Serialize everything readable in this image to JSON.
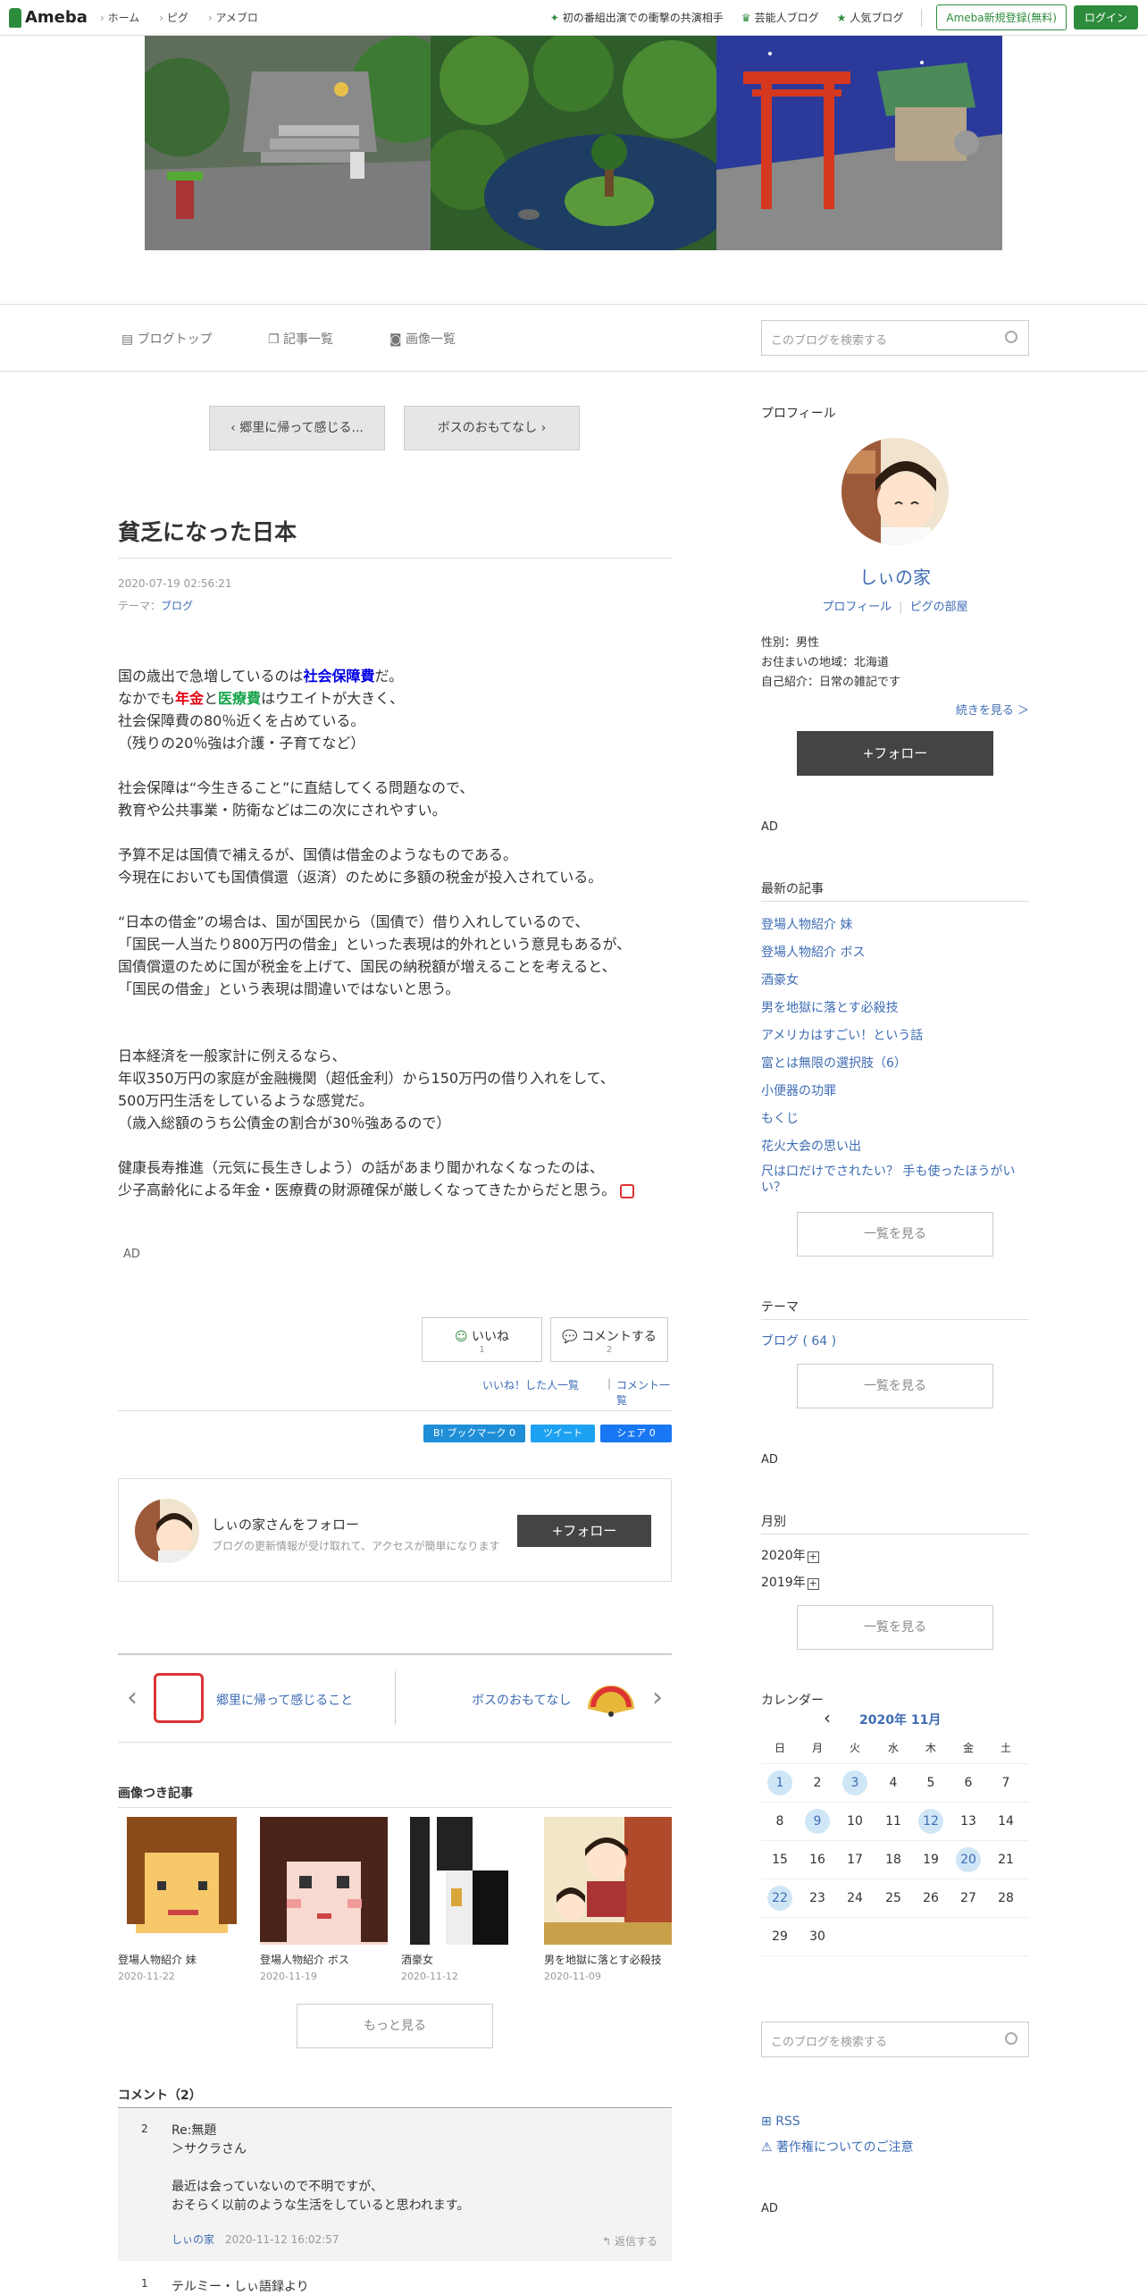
{
  "topbar": {
    "brand": "Ameba",
    "nav": [
      "ホーム",
      "ピグ",
      "アメブロ"
    ],
    "right_items": [
      "初の番組出演での衝撃の共演相手",
      "芸能人ブログ",
      "人気ブログ"
    ],
    "register": "Ameba新規登録(無料)",
    "login": "ログイン"
  },
  "subnav": {
    "items": [
      "ブログトップ",
      "記事一覧",
      "画像一覧"
    ],
    "search_placeholder": "このブログを検索する"
  },
  "article": {
    "prev": "郷里に帰って感じる...",
    "next": "ボスのおもてなし",
    "title": "貧乏になった日本",
    "date": "2020-07-19 02:56:21",
    "theme_label": "テーマ：",
    "theme": "ブログ",
    "p1a": "国の歳出で急増しているのは",
    "p1b": "社会保障費",
    "p1c": "だ。",
    "p1d": "なかでも",
    "p1e": "年金",
    "p1f": "と",
    "p1g": "医療費",
    "p1h": "はウエイトが大きく、",
    "p1i": "社会保障費の80％近くを占めている。",
    "p1j": "（残りの20％強は介護・子育てなど）",
    "p2a": "社会保障は“今生きること”に直結してくる問題なので、",
    "p2b": "教育や公共事業・防衛などは二の次にされやすい。",
    "p3a": "予算不足は国債で補えるが、国債は借金のようなものである。",
    "p3b": "今現在においても国債償還（返済）のために多額の税金が投入されている。",
    "p4a": "“日本の借金”の場合は、国が国民から（国債で）借り入れしているので、",
    "p4b": "「国民一人当たり800万円の借金」といった表現は的外れという意見もあるが、",
    "p4c": "国債償還のために国が税金を上げて、国民の納税額が増えることを考えると、",
    "p4d": "「国民の借金」という表現は間違いではないと思う。",
    "p5a": "日本経済を一般家計に例えるなら、",
    "p5b": "年収350万円の家庭が金融機関（超低金利）から150万円の借り入れをして、",
    "p5c": "500万円生活をしているような感覚だ。",
    "p5d": "（歳入総額のうち公債金の割合が30％強あるので）",
    "p6a": "健康長寿推進（元気に長生きしよう）の話があまり聞かれなくなったのは、",
    "p6b": "少子高齢化による年金・医療費の財源確保が厳しくなってきたからだと思う。",
    "ad": "AD",
    "like": "いいね",
    "like_count": "1",
    "comment": "コメントする",
    "comment_count": "2",
    "like_list": "いいね！した人一覧",
    "comment_list": "コメント一覧",
    "share_hatena": "B! ブックマーク  0",
    "share_tweet": "ツイート",
    "share_fb": "シェア 0",
    "follow_name": "しぃの家さんをフォロー",
    "follow_desc": "ブログの更新情報が受け取れて、アクセスが簡単になります",
    "follow_btn": "+フォロー",
    "prev_link": "郷里に帰って感じること",
    "next_link": "ボスのおもてなし",
    "img_heading": "画像つき記事",
    "thumbs": [
      {
        "t": "登場人物紹介 妹",
        "d": "2020-11-22"
      },
      {
        "t": "登場人物紹介 ボス",
        "d": "2020-11-19"
      },
      {
        "t": "酒豪女",
        "d": "2020-11-12"
      },
      {
        "t": "男を地獄に落とす必殺技",
        "d": "2020-11-09"
      }
    ],
    "more": "もっと見る",
    "comments_heading": "コメント（2）",
    "c2_num": "2",
    "c2_title": "Re:無題",
    "c2_l1": "＞サクラさん",
    "c2_l2": "最近は会っていないので不明ですが、",
    "c2_l3": "おそらく以前のような生活をしていると思われます。",
    "c2_author": "しぃの家",
    "c2_date": "2020-11-12 16:02:57",
    "c2_reply": "返信する",
    "c1_num": "1",
    "c1_title": "テルミー・しぃ語録より"
  },
  "sidebar": {
    "profile_h": "プロフィール",
    "name": "しぃの家",
    "profile_link": "プロフィール",
    "pigg_link": "ピグの部屋",
    "sex": "性別：男性",
    "area": "お住まいの地域：北海道",
    "intro": "自己紹介：日常の雑記です",
    "more": "続きを見る ＞",
    "follow": "+フォロー",
    "ad": "AD",
    "latest_h": "最新の記事",
    "latest": [
      "登場人物紹介 妹",
      "登場人物紹介 ボス",
      "酒豪女",
      "男を地獄に落とす必殺技",
      "アメリカはすごい！という話",
      "富とは無限の選択肢（6）",
      "小便器の功罪",
      "もくじ",
      "花火大会の思い出",
      "尺は口だけでされたい？ 手も使ったほうがいい？"
    ],
    "list_btn": "一覧を見る",
    "theme_h": "テーマ",
    "theme_item": "ブログ ( 64 )",
    "month_h": "月別",
    "years": [
      "2020年",
      "2019年"
    ],
    "cal_h": "カレンダー",
    "cal_month": "2020年 11月",
    "weekdays": [
      "日",
      "月",
      "火",
      "水",
      "木",
      "金",
      "土"
    ],
    "search_placeholder": "このブログを検索する",
    "rss": "RSS",
    "copyright": "著作権についてのご注意"
  },
  "colors": {
    "accent_green": "#2d8c3c",
    "link_blue": "#3e6cb4",
    "red": "#e60012"
  }
}
